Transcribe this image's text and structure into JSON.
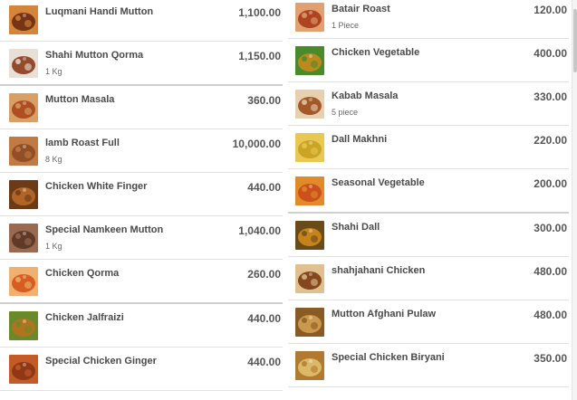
{
  "left_items": [
    {
      "name": "Luqmani Handi Mutton",
      "sub": "",
      "price": "1,100.00",
      "img": "curry-dish-icon",
      "c1": "#6b2a12",
      "c2": "#d4853a"
    },
    {
      "name": "Shahi Mutton Qorma",
      "sub": "1 Kg",
      "price": "1,150.00",
      "img": "qorma-bowl-icon",
      "c1": "#8a3b1a",
      "c2": "#e8e0d6"
    },
    {
      "name": "Mutton Masala",
      "sub": "",
      "price": "360.00",
      "img": "masala-dish-icon",
      "c1": "#a8461c",
      "c2": "#d8a066"
    },
    {
      "name": "lamb Roast Full",
      "sub": "8 Kg",
      "price": "10,000.00",
      "img": "roast-lamb-icon",
      "c1": "#8c4a22",
      "c2": "#c27a44"
    },
    {
      "name": "Chicken White Finger",
      "sub": "",
      "price": "440.00",
      "img": "finger-chicken-icon",
      "c1": "#b8692a",
      "c2": "#6b3a16"
    },
    {
      "name": "Special Namkeen Mutton",
      "sub": "1 Kg",
      "price": "1,040.00",
      "img": "namkeen-mutton-icon",
      "c1": "#5a3424",
      "c2": "#9a6a50"
    },
    {
      "name": "Chicken Qorma",
      "sub": "",
      "price": "260.00",
      "img": "chicken-qorma-icon",
      "c1": "#d4541a",
      "c2": "#f0b070"
    },
    {
      "name": "Chicken Jalfraizi",
      "sub": "",
      "price": "440.00",
      "img": "jalfrezi-dish-icon",
      "c1": "#b8701e",
      "c2": "#6a8a2a"
    },
    {
      "name": "Special Chicken Ginger",
      "sub": "",
      "price": "440.00",
      "img": "ginger-chicken-icon",
      "c1": "#8a3416",
      "c2": "#c45a26"
    }
  ],
  "right_items": [
    {
      "name": "Batair Roast",
      "sub": "1 Piece",
      "price": "120.00",
      "img": "roast-quail-icon",
      "c1": "#a83a18",
      "c2": "#e0a070"
    },
    {
      "name": "Chicken Vegetable",
      "sub": "",
      "price": "400.00",
      "img": "chicken-vegetable-icon",
      "c1": "#c88a1e",
      "c2": "#4a8a2a"
    },
    {
      "name": "Kabab Masala",
      "sub": "5 piece",
      "price": "330.00",
      "img": "kabab-masala-icon",
      "c1": "#9a4a1a",
      "c2": "#e6d0b0"
    },
    {
      "name": "Dall Makhni",
      "sub": "",
      "price": "220.00",
      "img": "dal-makhni-icon",
      "c1": "#c8a020",
      "c2": "#e8c850"
    },
    {
      "name": "Seasonal Vegetable",
      "sub": "",
      "price": "200.00",
      "img": "seasonal-vegetable-icon",
      "c1": "#c84a1a",
      "c2": "#e08a2a"
    },
    {
      "name": "Shahi Dall",
      "sub": "",
      "price": "300.00",
      "img": "shahi-dal-icon",
      "c1": "#d08a1a",
      "c2": "#6a4a18"
    },
    {
      "name": "shahjahani Chicken",
      "sub": "",
      "price": "480.00",
      "img": "shahjahani-chicken-icon",
      "c1": "#7a3a14",
      "c2": "#e0c090"
    },
    {
      "name": "Mutton Afghani Pulaw",
      "sub": "",
      "price": "480.00",
      "img": "afghani-pulao-icon",
      "c1": "#d0a050",
      "c2": "#8a5a24"
    },
    {
      "name": "Special Chicken Biryani",
      "sub": "",
      "price": "350.00",
      "img": "chicken-biryani-icon",
      "c1": "#e0c070",
      "c2": "#b07a30"
    }
  ]
}
